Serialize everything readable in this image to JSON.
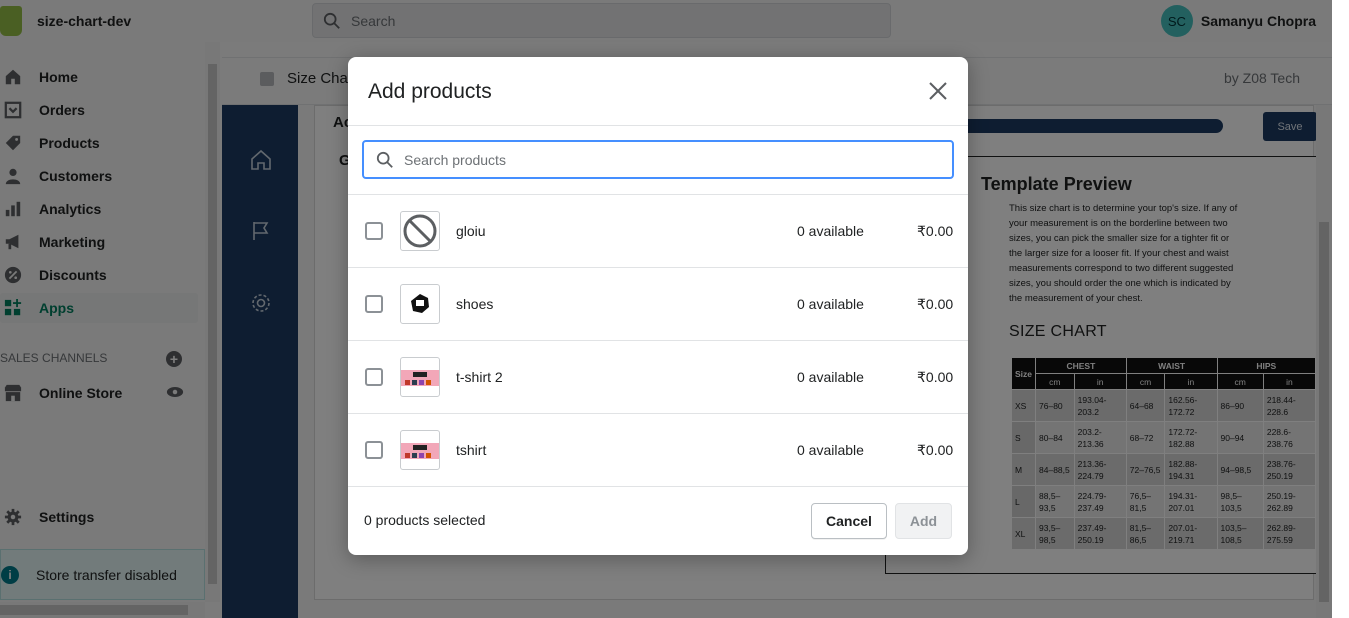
{
  "topbar": {
    "store_name": "size-chart-dev",
    "search_placeholder": "Search",
    "user_initials": "SC",
    "user_name": "Samanyu Chopra"
  },
  "sidebar": {
    "items": [
      {
        "label": "Home",
        "icon": "home-icon"
      },
      {
        "label": "Orders",
        "icon": "orders-icon"
      },
      {
        "label": "Products",
        "icon": "tag-icon"
      },
      {
        "label": "Customers",
        "icon": "person-icon"
      },
      {
        "label": "Analytics",
        "icon": "bar-chart-icon"
      },
      {
        "label": "Marketing",
        "icon": "megaphone-icon"
      },
      {
        "label": "Discounts",
        "icon": "discount-icon"
      },
      {
        "label": "Apps",
        "icon": "apps-icon",
        "active": true
      }
    ],
    "sales_channels_label": "SALES CHANNELS",
    "online_store": "Online Store",
    "settings": "Settings",
    "store_transfer": "Store transfer disabled"
  },
  "app_header": {
    "title": "Size Char",
    "by": "by Z08 Tech"
  },
  "background": {
    "save_label": "Save",
    "partial_a": "Ac",
    "partial_g": "G",
    "preview_title": "Template Preview",
    "preview_text": "This size chart is to determine your top's size. If any of your measurement is on the borderline between two sizes, you can pick the smaller size for a tighter fit or the larger size for a looser fit. If your chest and waist measurements correspond to two different suggested sizes, you should order the one which is indicated by the measurement of your chest.",
    "size_chart_title": "SIZE CHART",
    "table": {
      "size_header": "Size",
      "groups": [
        "CHEST",
        "WAIST",
        "HIPS"
      ],
      "units": [
        "cm",
        "in",
        "cm",
        "in",
        "cm",
        "in"
      ],
      "rows": [
        [
          "XS",
          "76–80",
          "193.04-203.2",
          "64–68",
          "162.56-172.72",
          "86–90",
          "218.44-228.6"
        ],
        [
          "S",
          "80–84",
          "203.2-213.36",
          "68–72",
          "172.72-182.88",
          "90–94",
          "228.6-238.76"
        ],
        [
          "M",
          "84–88,5",
          "213.36-224.79",
          "72–76,5",
          "182.88-194.31",
          "94–98,5",
          "238.76-250.19"
        ],
        [
          "L",
          "88,5–93,5",
          "224.79-237.49",
          "76,5–81,5",
          "194.31-207.01",
          "98,5–103,5",
          "250.19-262.89"
        ],
        [
          "XL",
          "93,5–98,5",
          "237.49-250.19",
          "81,5–86,5",
          "207.01-219.71",
          "103,5–108,5",
          "262.89-275.59"
        ]
      ]
    }
  },
  "modal": {
    "title": "Add products",
    "search_placeholder": "Search products",
    "products": [
      {
        "name": "gloiu",
        "available": "0 available",
        "price": "₹0.00",
        "thumb": "no-image-icon"
      },
      {
        "name": "shoes",
        "available": "0 available",
        "price": "₹0.00",
        "thumb": "shoe-image"
      },
      {
        "name": "t-shirt 2",
        "available": "0 available",
        "price": "₹0.00",
        "thumb": "tshirt-image"
      },
      {
        "name": "tshirt",
        "available": "0 available",
        "price": "₹0.00",
        "thumb": "tshirt-image"
      }
    ],
    "selected_count": "0 products selected",
    "cancel_label": "Cancel",
    "add_label": "Add"
  }
}
